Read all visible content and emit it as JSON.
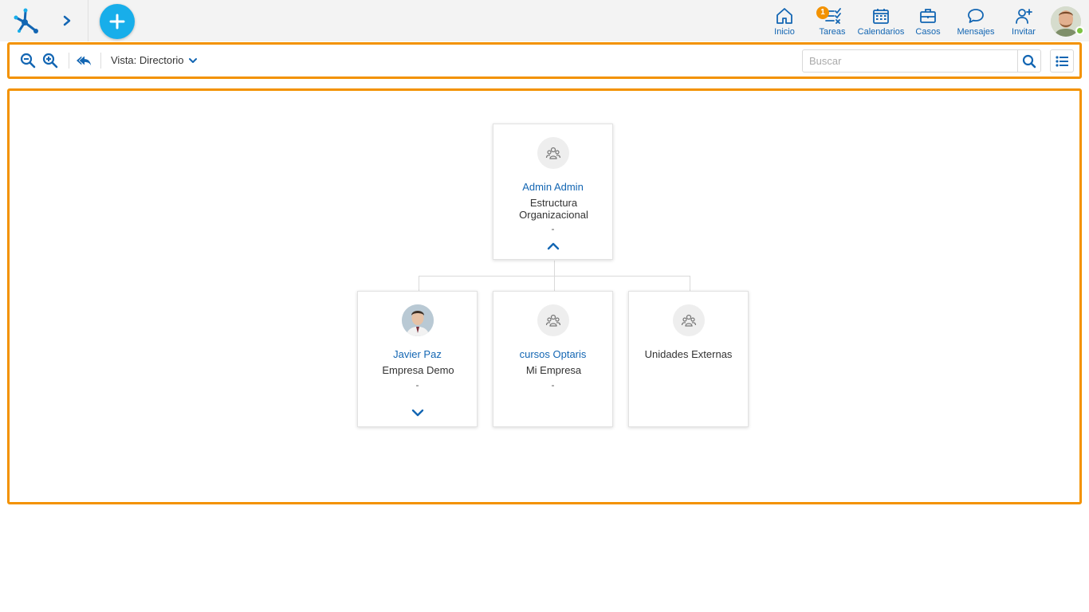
{
  "header": {
    "nav": [
      {
        "key": "inicio",
        "label": "Inicio",
        "icon": "home-icon"
      },
      {
        "key": "tareas",
        "label": "Tareas",
        "icon": "tasks-icon",
        "badge": "1"
      },
      {
        "key": "calendarios",
        "label": "Calendarios",
        "icon": "calendar-icon"
      },
      {
        "key": "casos",
        "label": "Casos",
        "icon": "briefcase-icon"
      },
      {
        "key": "mensajes",
        "label": "Mensajes",
        "icon": "chat-icon"
      },
      {
        "key": "invitar",
        "label": "Invitar",
        "icon": "invite-user-icon"
      }
    ]
  },
  "toolbar": {
    "view_label": "Vista: Directorio",
    "search_placeholder": "Buscar"
  },
  "org": {
    "root": {
      "name": "Admin Admin",
      "unit": "Estructura Organizacional",
      "extra": "-",
      "icon": "group-icon"
    },
    "children": [
      {
        "name": "Javier Paz",
        "unit": "Empresa Demo",
        "extra": "-",
        "icon": "user-photo"
      },
      {
        "name": "cursos Optaris",
        "unit": "Mi Empresa",
        "extra": "-",
        "icon": "group-icon"
      },
      {
        "name": "Unidades Externas",
        "unit": "",
        "extra": "",
        "icon": "group-icon"
      }
    ]
  },
  "colors": {
    "accent": "#1366b3",
    "highlight": "#f39200",
    "add_button": "#18aeea",
    "online": "#7cc243"
  }
}
